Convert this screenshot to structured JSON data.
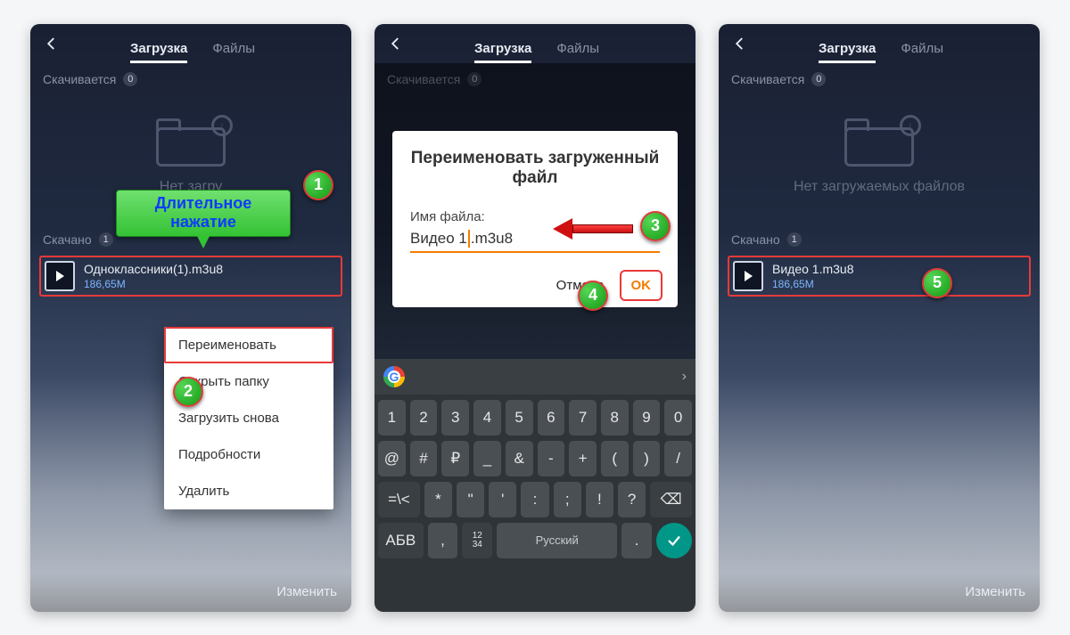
{
  "tabs": {
    "download": "Загрузка",
    "files": "Файлы"
  },
  "section": {
    "downloading": "Скачивается",
    "downloaded": "Скачано"
  },
  "counts": {
    "downloading": "0",
    "downloaded": "1"
  },
  "empty1": "Нет загру",
  "empty3": "Нет загружаемых файлов",
  "file1": {
    "name": "Одноклассники(1).m3u8",
    "size": "186,65M"
  },
  "file3": {
    "name": "Видео 1.m3u8",
    "size": "186,65M"
  },
  "bottom": {
    "edit": "Изменить"
  },
  "ctx": {
    "rename": "Переименовать",
    "openFolder": "Открыть папку",
    "redownload": "Загрузить снова",
    "details": "Подробности",
    "delete": "Удалить"
  },
  "hint": "Длительное нажатие",
  "dialog": {
    "title": "Переименовать загруженный файл",
    "label": "Имя файла:",
    "value_a": "Видео 1",
    "value_b": ".m3u8",
    "cancel": "Отмена",
    "ok": "OK"
  },
  "ghostSize": "186,65M",
  "steps": {
    "s1": "1",
    "s2": "2",
    "s3": "3",
    "s4": "4",
    "s5": "5"
  },
  "kbd": {
    "r1": [
      "1",
      "2",
      "3",
      "4",
      "5",
      "6",
      "7",
      "8",
      "9",
      "0"
    ],
    "r2": [
      "@",
      "#",
      "₽",
      "_",
      "&",
      "-",
      "+",
      "(",
      ")",
      "/"
    ],
    "r3_shift": "=\\<",
    "r3": [
      "*",
      "\"",
      "'",
      ":",
      ";",
      "!",
      "?"
    ],
    "r3_bsp": "⌫",
    "r4_abc": "АБВ",
    "r4_comma": ",",
    "r4_nums": "12\n34",
    "r4_space": "Русский",
    "r4_dot": "."
  }
}
